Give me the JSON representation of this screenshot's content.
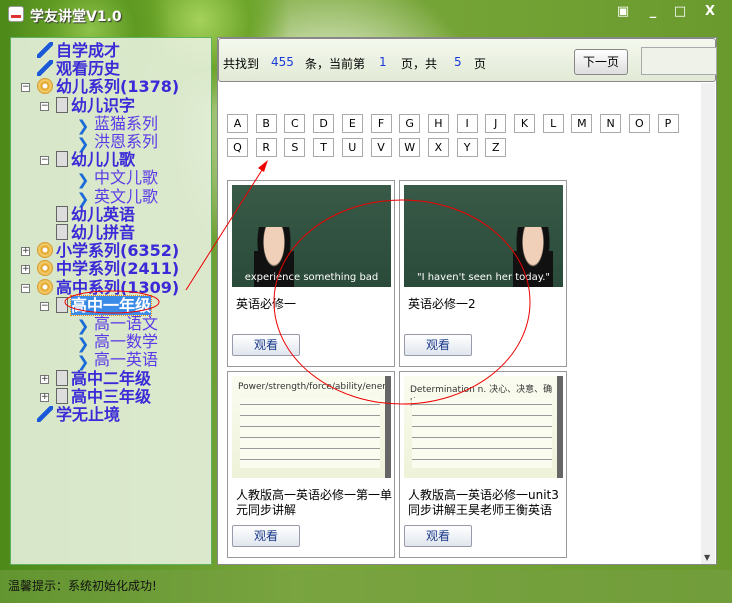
{
  "window": {
    "title": "学友讲堂V1.0",
    "controls": [
      "▣",
      "_",
      "□",
      "X"
    ]
  },
  "tree": [
    {
      "label": "自学成才",
      "icon": "pen"
    },
    {
      "label": "观看历史",
      "icon": "pen"
    },
    {
      "label": "幼儿系列(1378)",
      "icon": "disc",
      "exp": "−"
    },
    {
      "label": "幼儿识字",
      "icon": "page",
      "exp": "−"
    },
    {
      "label": "蓝猫系列",
      "icon": "chev"
    },
    {
      "label": "洪恩系列",
      "icon": "chev"
    },
    {
      "label": "幼儿儿歌",
      "icon": "page",
      "exp": "−"
    },
    {
      "label": "中文儿歌",
      "icon": "chev"
    },
    {
      "label": "英文儿歌",
      "icon": "chev"
    },
    {
      "label": "幼儿英语",
      "icon": "page"
    },
    {
      "label": "幼儿拼音",
      "icon": "page"
    },
    {
      "label": "小学系列(6352)",
      "icon": "disc",
      "exp": "+"
    },
    {
      "label": "中学系列(2411)",
      "icon": "disc",
      "exp": "+"
    },
    {
      "label": "高中系列(1309)",
      "icon": "disc",
      "exp": "−"
    },
    {
      "label": "高中一年级",
      "icon": "page",
      "exp": "−",
      "selected": true
    },
    {
      "label": "高一语文",
      "icon": "chev"
    },
    {
      "label": "高一数学",
      "icon": "chev"
    },
    {
      "label": "高一英语",
      "icon": "chev"
    },
    {
      "label": "高中二年级",
      "icon": "page",
      "exp": "+"
    },
    {
      "label": "高中三年级",
      "icon": "page",
      "exp": "+"
    },
    {
      "label": "学无止境",
      "icon": "pen"
    }
  ],
  "pager": {
    "found_prefix": "共找到",
    "total": "455",
    "mid": "条，当前第",
    "current": "1",
    "pages_prefix": "页，共",
    "pages": "5",
    "suffix": "页",
    "next": "下一页"
  },
  "letters": [
    "A",
    "B",
    "C",
    "D",
    "E",
    "F",
    "G",
    "H",
    "I",
    "J",
    "K",
    "L",
    "M",
    "N",
    "O",
    "P",
    "Q",
    "R",
    "S",
    "T",
    "U",
    "V",
    "W",
    "X",
    "Y",
    "Z"
  ],
  "cards": [
    {
      "title": "英语必修一",
      "thumb": "board",
      "caption": "experience something bad",
      "watch": "观看"
    },
    {
      "title": "英语必修一2",
      "thumb": "board",
      "caption": "\"I haven't seen her today.\"",
      "watch": "观看"
    },
    {
      "title": "人教版高一英语必修一第一单元同步讲解",
      "thumb": "slide",
      "caption": "Power/strength/force/ability/energy",
      "watch": "观看"
    },
    {
      "title": "人教版高一英语必修一unit3同步讲解王昊老师王衡英语",
      "thumb": "slide",
      "caption": "Determination n. 决心、决意、确定",
      "watch": "观看"
    }
  ],
  "status": "温馨提示：系统初始化成功!"
}
